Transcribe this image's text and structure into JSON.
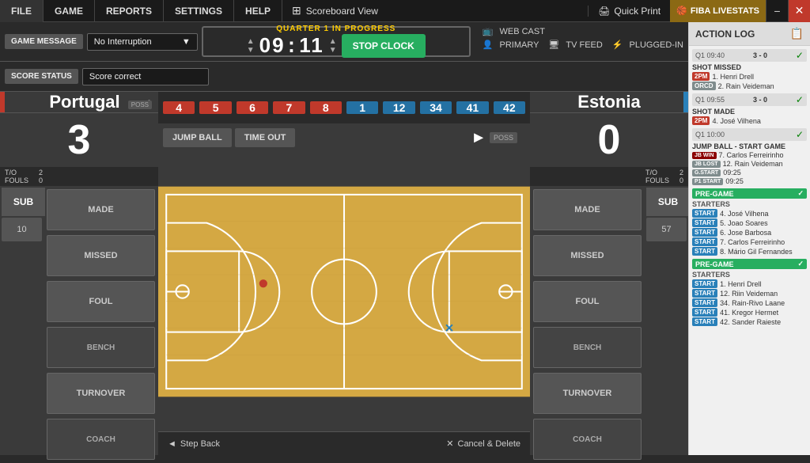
{
  "menubar": {
    "file": "FILE",
    "game": "GAME",
    "reports": "REPORTS",
    "settings": "SETTINGS",
    "help": "HELP",
    "scoreboard": "Scoreboard View",
    "quick_print": "Quick Print",
    "fiba": "FIBA LIVESTATS",
    "minimize": "−",
    "close": "✕"
  },
  "game_message": {
    "label": "GAME MESSAGE",
    "value": "No Interruption",
    "dropdown_arrow": "▼"
  },
  "score_status": {
    "label": "SCORE STATUS",
    "value": "Score correct"
  },
  "quarter": {
    "title": "QUARTER 1 IN PROGRESS",
    "minutes": "09",
    "seconds": "11",
    "stop_clock": "STOP CLOCK"
  },
  "webcast": {
    "title": "WEB CAST",
    "primary": "PRIMARY",
    "tv_feed": "TV FEED",
    "plugged_in": "PLUGGED-IN"
  },
  "team_left": {
    "name": "Portugal",
    "score": "3",
    "to": "T/O",
    "to_val": "2",
    "fouls": "FOULS",
    "fouls_val": "0",
    "players": [
      "4",
      "5",
      "6",
      "7",
      "8"
    ],
    "sub": "SUB",
    "made": "MADE",
    "missed": "MISSED",
    "foul": "FOUL",
    "bench": "BENCH",
    "coach": "COACH",
    "turnover": "TURNOVER",
    "poss": "POSS"
  },
  "team_right": {
    "name": "Estonia",
    "score": "0",
    "to": "T/O",
    "to_val": "2",
    "fouls": "FOULS",
    "fouls_val": "0",
    "players": [
      "1",
      "12",
      "34",
      "41",
      "42"
    ],
    "sub": "SUB",
    "made": "MADE",
    "missed": "MISSED",
    "foul": "FOUL",
    "bench": "BENCH",
    "coach": "COACH",
    "turnover": "TURNOVER",
    "poss": "POSS",
    "bench_num": "57",
    "left_num": "10"
  },
  "center": {
    "jump_ball": "JUMP BALL",
    "time_out": "TIME OUT",
    "step_back": "Step Back",
    "cancel_delete": "Cancel & Delete"
  },
  "action_log": {
    "title": "ACTION LOG",
    "entries": [
      {
        "time": "Q1  09:40",
        "score": "3 - 0",
        "category": "SHOT MISSED",
        "players": [
          {
            "badge": "2PM",
            "badge_class": "badge-2pm",
            "name": "1. Henri Drell"
          },
          {
            "badge": "ORCD",
            "badge_class": "badge-orcd",
            "name": "2. Rain Veideman"
          }
        ]
      },
      {
        "time": "Q1  09:55",
        "score": "3 - 0",
        "category": "SHOT MADE",
        "players": [
          {
            "badge": "2PM",
            "badge_class": "badge-2pm",
            "name": "4. José Vilhena"
          }
        ]
      },
      {
        "time": "Q1  10:00",
        "score": "",
        "category": "JUMP BALL - START GAME",
        "players": [
          {
            "badge": "JB WIN",
            "badge_class": "badge-2pm",
            "name": "7. Carlos Ferreirinho"
          },
          {
            "badge": "JB LOST",
            "badge_class": "badge-orcd",
            "name": "12. Rain Veideman"
          },
          {
            "badge": "G.START",
            "badge_class": "badge-q-start",
            "name": "09:25"
          },
          {
            "badge": "P1 START",
            "badge_class": "badge-q-start",
            "name": "09:25"
          }
        ]
      },
      {
        "section": "PRE-GAME LEFT",
        "starters": [
          {
            "name": "4. José Vilhena"
          },
          {
            "name": "5. Joao Soares"
          },
          {
            "name": "6. Jose Barbosa"
          },
          {
            "name": "7. Carlos Ferreirinho"
          },
          {
            "name": "8. Mário Gil Fernandes"
          }
        ]
      },
      {
        "section": "PRE-GAME RIGHT",
        "starters": [
          {
            "name": "1. Henri Drell"
          },
          {
            "name": "12. Riin Veideman"
          },
          {
            "name": "34. Rain-Rivo Laane"
          },
          {
            "name": "41. Kregor Hermet"
          },
          {
            "name": "42. Sander Raieste"
          }
        ]
      }
    ]
  }
}
